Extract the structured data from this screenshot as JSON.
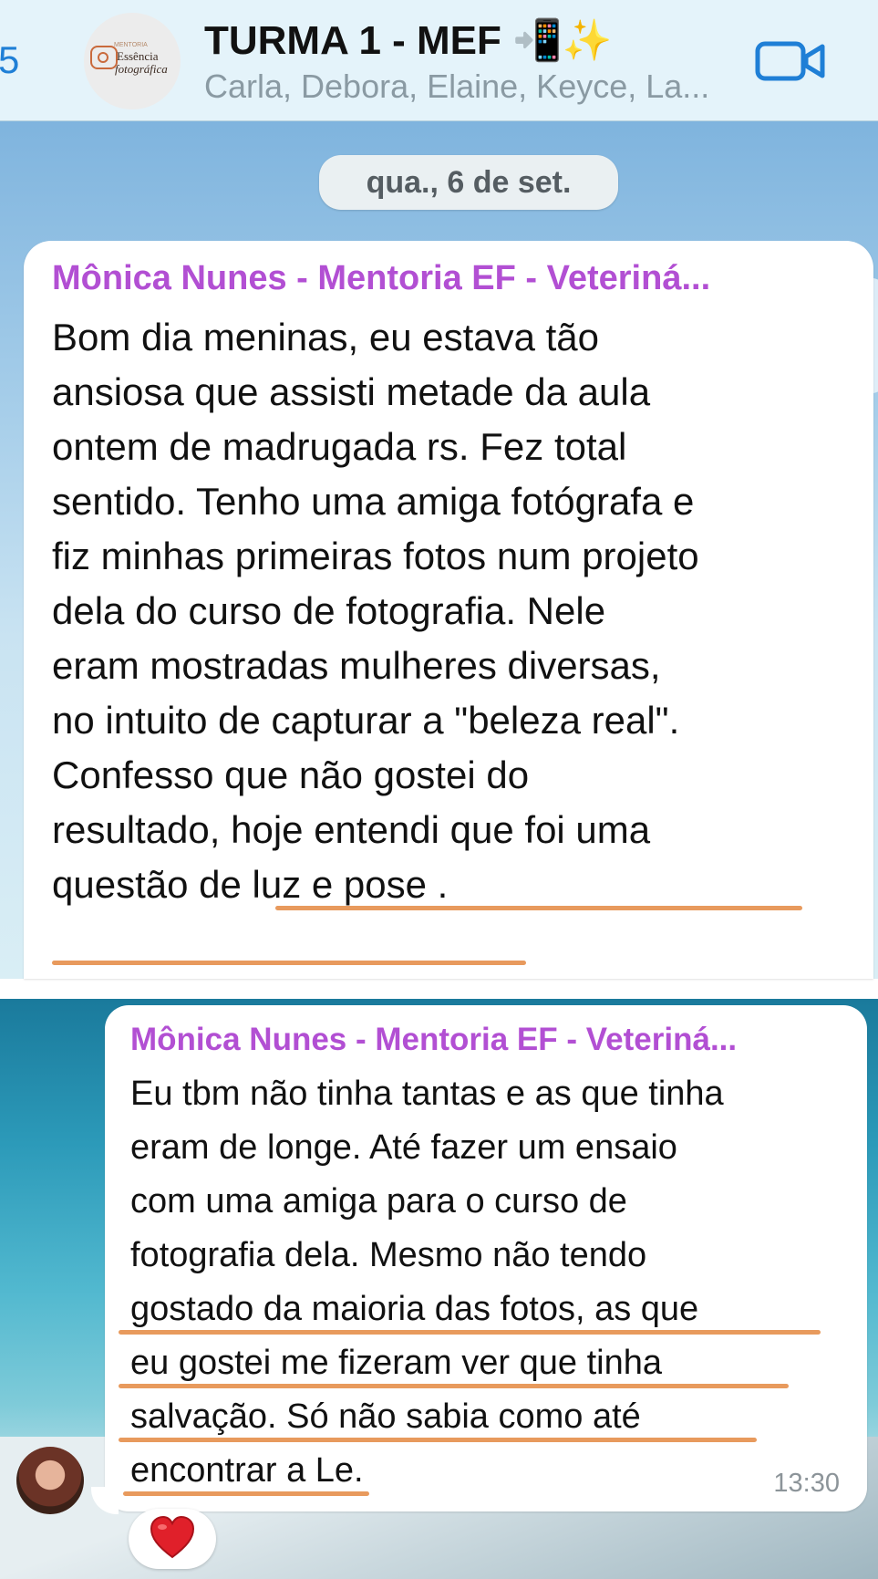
{
  "header": {
    "back_count": "5",
    "group_avatar": {
      "brand_small": "MENTORIA",
      "brand_main": "Essência",
      "brand_sub": "fotográfica"
    },
    "title": "TURMA 1 - MEF 📲✨",
    "subtitle": "Carla, Debora, Elaine, Keyce, La...",
    "video_call_icon": "video-camera-icon"
  },
  "chat": {
    "date": "qua., 6 de set.",
    "messages": [
      {
        "sender": "Mônica Nunes - Mentoria EF - Veteriná...",
        "lines": [
          "Bom dia meninas, eu estava tão",
          "ansiosa que assisti metade da aula",
          "ontem de madrugada rs. Fez total",
          "sentido. Tenho uma amiga fotógrafa e",
          "fiz minhas primeiras fotos num projeto",
          "dela do curso de fotografia. Nele",
          "eram mostradas mulheres diversas,",
          "no intuito de  capturar a \"beleza real\".",
          "Confesso que não gostei do",
          "resultado, hoje entendi que foi uma",
          "questão de luz e pose ."
        ]
      },
      {
        "sender": "Mônica Nunes - Mentoria EF - Veteriná...",
        "lines": [
          "Eu tbm não tinha tantas e as que tinha",
          "eram de longe. Até fazer um ensaio",
          "com uma amiga para o curso de",
          "fotografia dela. Mesmo não tendo",
          "gostado da maioria das fotos, as que",
          "eu gostei me fizeram ver que tinha",
          "salvação. Só não sabia como até",
          "encontrar a Le."
        ],
        "time": "13:30",
        "reaction": "❤️"
      }
    ]
  },
  "colors": {
    "sender_name": "#b24fd3",
    "link_blue": "#1f7fd6",
    "underline_annotation": "#e89a5d"
  }
}
